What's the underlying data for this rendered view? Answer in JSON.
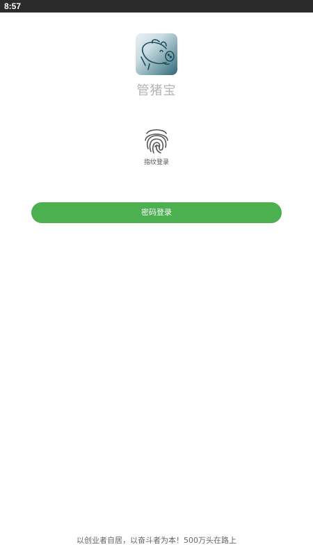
{
  "status_bar": {
    "time": "8:57"
  },
  "app": {
    "name": "管猪宝",
    "logo_icon": "pig-logo-icon"
  },
  "fingerprint": {
    "icon": "fingerprint-icon",
    "label": "指纹登录"
  },
  "password_login": {
    "label": "密码登录",
    "color": "#4caf50"
  },
  "footer": {
    "slogan": "以创业者自居，以奋斗者为本！500万头在路上"
  }
}
